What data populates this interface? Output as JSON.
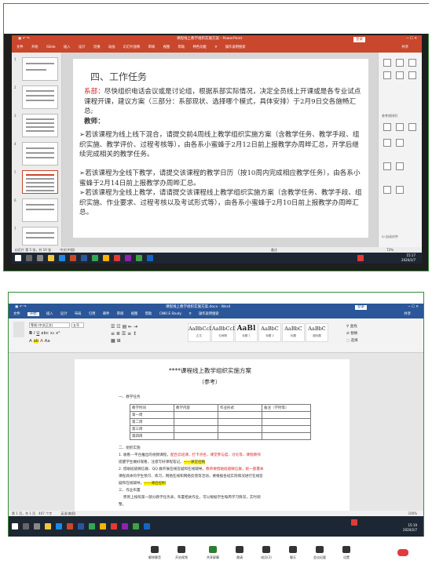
{
  "ppt": {
    "title": "课程线上教学组织实施方案 - PowerPoint",
    "header_right": "登录",
    "tabs": [
      "文件",
      "开始",
      "iSlide",
      "插入",
      "设计",
      "切换",
      "动画",
      "幻灯片放映",
      "审阅",
      "视图",
      "帮助",
      "特色功能",
      "操作说明搜索"
    ],
    "share": "共享",
    "slide": {
      "title": "四、工作任务",
      "lines": [
        {
          "label": "系部：",
          "text": "尽快组织电话会议或是讨论组，根据系部实际情况，决定全员线上开课或是各专业试点课程开课，建议方案（三部分：系部现状、选择哪个模式，具体安排）于2月9日交各施畅汇总;"
        },
        {
          "label": "教师：",
          "text": ""
        }
      ],
      "bullets": [
        "若该课程为线上线下混合，请提交前4周线上教学组织实施方案（含教学任务、教学手段、组织实施、教学评价、过程考核等），由各系小蜜蜂于2月12日前上报教学办周晔汇总，开学后继续完成相关的教学任务。",
        "若该课程为全线下教学，请提交该课程的教学日历（按10周内完成相应教学任务），由各系小蜜蜂于2月14日前上报教学办周晔汇总。",
        "若该课程为全线上教学，请请提交该课程线上教学组织实施方案（含教学任务、教学手段、组织实施、作业要求、过程考核以及考试形式等），由各系小蜜蜂于2月10日前上报教学办周晔汇总。"
      ]
    },
    "thumb_numbers": [
      "1",
      "2",
      "3",
      "4",
      "5",
      "6",
      "7"
    ],
    "status_left": "幻灯片 第 5 张，共 10 张",
    "status_lang": "中文(中国)",
    "status_notes": "备注",
    "status_zoom": "72%",
    "side_panel": {
      "ref_label": "参考线排列",
      "auto_label": "自动对齐"
    },
    "clock_time": "15:17",
    "clock_date": "2020/2/7"
  },
  "word": {
    "title": "课程线上教学组织实施方案.docx - Word",
    "header_right": "登录",
    "tabs": [
      "文件",
      "开始",
      "插入",
      "设计",
      "布局",
      "引用",
      "邮件",
      "审阅",
      "视图",
      "帮助",
      "CNKI E-Study",
      "操作说明搜索"
    ],
    "share": "共享",
    "font_name": "等线 (中文正文)",
    "font_size": "五号",
    "styles": [
      {
        "sample": "AaBbCcDc",
        "name": "正文"
      },
      {
        "sample": "AaBbCcDc",
        "name": "无间隔"
      },
      {
        "sample": "AaBl",
        "name": "标题 1"
      },
      {
        "sample": "AaBbC",
        "name": "标题 2"
      },
      {
        "sample": "AaBbC",
        "name": "标题"
      },
      {
        "sample": "AaBbC",
        "name": "副标题"
      }
    ],
    "doc": {
      "title": "****课程线上教学组织实施方案",
      "subtitle": "（参考）",
      "sec1": "一、教学任务",
      "table_header": [
        "教学时间",
        "教学内容",
        "作业形式",
        "备注（学时等）"
      ],
      "table_rows": [
        "第一周",
        "第二周",
        "第三周",
        "第四周"
      ],
      "sec2": "二、组织实施",
      "item1_a": "1. 收看---平台推出的视频课程，",
      "item1_b": "配合云班课，打卡点名，课堂参与度、讨论等、课程教师",
      "item1_c": "提醒学生做好观看，注意写好课程笔记。",
      "item1_hl": "——课堂控制",
      "item2_a": "2. 借助班级微信群、QQ 群开展在线答疑和在线辅导。",
      "item2_b": "教师要借助班级微信群，统一部署本",
      "item2_c": "课程具体的学生预习、练习，网络在线和网络反馈等活动，要根据各班实际情况进行在线答",
      "item2_d": "疑和在线辅导。",
      "item2_hl": "——课后控制",
      "sec3": "三、作业布置",
      "item3_a": "原则上按照第一部分教学任务表，布置相关作业，可以根据学生每周学习情况，实时调",
      "item3_b": "整。"
    },
    "status_left": "第 1 页，共 1 页　407 个字",
    "status_lang": "英语(美国)",
    "status_zoom": "100%",
    "clock_time": "15:19",
    "clock_date": "2020/2/7"
  },
  "meeting": {
    "buttons": [
      "解除静音",
      "开启视频",
      "共享屏幕",
      "邀请",
      "成员(2)",
      "聊天",
      "会议纪要",
      "设置"
    ]
  }
}
